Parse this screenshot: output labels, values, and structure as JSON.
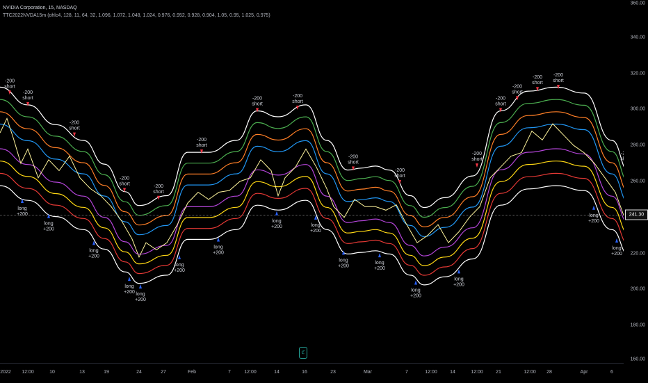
{
  "header": {
    "symbol_line": "NVIDIA Corporation, 15, NASDAQ",
    "indicator_line": "TTC2022NVDA15m (ohlc4, 128, 11, 64, 32, 1.096, 1.072, 1.048, 1.024, 0.976, 0.952, 0.928, 0.904, 1.05, 0.95, 1.025, 0.975)"
  },
  "last_price": "241.30",
  "logo_text": "ℭ",
  "colors": {
    "background": "#000000",
    "band_outer": "#ffffff",
    "band_green": "#4caf50",
    "band_orange": "#ff7f27",
    "band_blue": "#2196f3",
    "band_purple": "#b445d9",
    "band_yellow": "#ffd814",
    "band_red": "#e53935",
    "price_line": "#fff59d",
    "signal_short": "#f23645",
    "signal_long": "#2962ff",
    "axis_text": "#b2b5be"
  },
  "chart_data": {
    "type": "line",
    "title": "NVIDIA Corporation, 15, NASDAQ",
    "xlabel": "",
    "ylabel": "",
    "ylim": [
      160,
      360
    ],
    "y_ticks": [
      "160.00",
      "180.00",
      "200.00",
      "220.00",
      "240.00",
      "260.00",
      "280.00",
      "300.00",
      "320.00",
      "340.00",
      "360.00"
    ],
    "x_ticks": [
      {
        "label": "2022",
        "i": 8
      },
      {
        "label": "12:00",
        "i": 40
      },
      {
        "label": "10",
        "i": 75
      },
      {
        "label": "13",
        "i": 118
      },
      {
        "label": "19",
        "i": 153
      },
      {
        "label": "24",
        "i": 200
      },
      {
        "label": "27",
        "i": 235
      },
      {
        "label": "Feb",
        "i": 276
      },
      {
        "label": "7",
        "i": 330
      },
      {
        "label": "12:00",
        "i": 360
      },
      {
        "label": "14",
        "i": 398
      },
      {
        "label": "16",
        "i": 438
      },
      {
        "label": "23",
        "i": 479
      },
      {
        "label": "Mar",
        "i": 529
      },
      {
        "label": "7",
        "i": 585
      },
      {
        "label": "12:00",
        "i": 620
      },
      {
        "label": "14",
        "i": 651
      },
      {
        "label": "12:00",
        "i": 686
      },
      {
        "label": "21",
        "i": 717
      },
      {
        "label": "12:00",
        "i": 762
      },
      {
        "label": "28",
        "i": 790
      },
      {
        "label": "Apr",
        "i": 840
      },
      {
        "label": "6",
        "i": 880
      }
    ],
    "base_curve": {
      "x": [
        0,
        40,
        80,
        120,
        150,
        180,
        200,
        240,
        270,
        300,
        340,
        370,
        400,
        440,
        470,
        500,
        520,
        540,
        560,
        590,
        610,
        640,
        680,
        720,
        760,
        800,
        840,
        880,
        905
      ],
      "center": [
        285,
        276,
        266,
        258,
        246,
        232,
        225,
        230,
        252,
        252,
        258,
        273,
        270,
        276,
        258,
        243,
        244,
        245,
        243,
        230,
        224,
        229,
        240,
        273,
        283,
        285,
        282,
        258,
        242
      ]
    },
    "bands": [
      {
        "level": 1.096,
        "color": "#ffffff"
      },
      {
        "level": 1.072,
        "color": "#4caf50"
      },
      {
        "level": 1.048,
        "color": "#ff7f27"
      },
      {
        "level": 1.024,
        "color": "#2196f3"
      },
      {
        "level": 0.976,
        "color": "#b445d9"
      },
      {
        "level": 0.952,
        "color": "#ffd814"
      },
      {
        "level": 0.928,
        "color": "#e53935"
      },
      {
        "level": 0.904,
        "color": "#ffffff"
      }
    ],
    "price_series": {
      "x": [
        0,
        10,
        20,
        30,
        40,
        55,
        70,
        85,
        100,
        115,
        130,
        145,
        160,
        175,
        190,
        200,
        210,
        225,
        240,
        255,
        270,
        285,
        300,
        315,
        330,
        345,
        360,
        375,
        390,
        400,
        410,
        425,
        440,
        455,
        470,
        480,
        495,
        510,
        525,
        540,
        555,
        570,
        585,
        600,
        615,
        630,
        645,
        660,
        675,
        690,
        705,
        720,
        735,
        750,
        765,
        780,
        795,
        810,
        825,
        840,
        855,
        870,
        885,
        900,
        905
      ],
      "y": [
        287,
        295,
        283,
        270,
        278,
        262,
        272,
        266,
        274,
        262,
        256,
        252,
        246,
        238,
        228,
        218,
        226,
        222,
        226,
        236,
        248,
        254,
        250,
        254,
        255,
        260,
        262,
        272,
        266,
        252,
        262,
        268,
        278,
        268,
        256,
        246,
        240,
        250,
        246,
        246,
        244,
        247,
        236,
        226,
        230,
        236,
        226,
        232,
        240,
        246,
        262,
        268,
        274,
        276,
        288,
        283,
        292,
        286,
        280,
        276,
        270,
        262,
        254,
        238,
        241
      ]
    },
    "signals": [
      {
        "i": 14,
        "side": "short",
        "text": "-200",
        "sub": "short"
      },
      {
        "i": 32,
        "side": "long",
        "text": "long",
        "sub": "+200"
      },
      {
        "i": 40,
        "side": "short",
        "text": "-200",
        "sub": "short"
      },
      {
        "i": 70,
        "side": "long",
        "text": "long",
        "sub": "+200"
      },
      {
        "i": 107,
        "side": "short",
        "text": "-200",
        "sub": "short"
      },
      {
        "i": 135,
        "side": "long",
        "text": "long",
        "sub": "+200"
      },
      {
        "i": 179,
        "side": "short",
        "text": "-200",
        "sub": "short"
      },
      {
        "i": 186,
        "side": "long",
        "text": "long",
        "sub": "+200"
      },
      {
        "i": 202,
        "side": "long",
        "text": "long",
        "sub": "+200"
      },
      {
        "i": 228,
        "side": "short",
        "text": "-200",
        "sub": "short"
      },
      {
        "i": 258,
        "side": "long",
        "text": "long",
        "sub": "+200"
      },
      {
        "i": 290,
        "side": "short",
        "text": "-200",
        "sub": "short"
      },
      {
        "i": 314,
        "side": "long",
        "text": "long",
        "sub": "+200"
      },
      {
        "i": 370,
        "side": "short",
        "text": "-200",
        "sub": "short"
      },
      {
        "i": 398,
        "side": "long",
        "text": "long",
        "sub": "+200"
      },
      {
        "i": 428,
        "side": "short",
        "text": "-200",
        "sub": "short"
      },
      {
        "i": 454,
        "side": "long",
        "text": "long",
        "sub": "+200"
      },
      {
        "i": 494,
        "side": "long",
        "text": "long",
        "sub": "+200"
      },
      {
        "i": 508,
        "side": "short",
        "text": "-200",
        "sub": "short"
      },
      {
        "i": 546,
        "side": "long",
        "text": "long",
        "sub": "+200"
      },
      {
        "i": 575,
        "side": "short",
        "text": "-200",
        "sub": "short"
      },
      {
        "i": 598,
        "side": "long",
        "text": "long",
        "sub": "+200"
      },
      {
        "i": 660,
        "side": "long",
        "text": "long",
        "sub": "+200"
      },
      {
        "i": 686,
        "side": "short",
        "text": "-200",
        "sub": "short"
      },
      {
        "i": 720,
        "side": "short",
        "text": "-200",
        "sub": "short"
      },
      {
        "i": 744,
        "side": "short",
        "text": "-200",
        "sub": "short"
      },
      {
        "i": 773,
        "side": "short",
        "text": "-200",
        "sub": "short"
      },
      {
        "i": 803,
        "side": "short",
        "text": "-200",
        "sub": "short"
      },
      {
        "i": 854,
        "side": "long",
        "text": "long",
        "sub": "+200"
      },
      {
        "i": 887,
        "side": "long",
        "text": "long",
        "sub": "+200"
      },
      {
        "i": 900,
        "side": "short",
        "text": "-200",
        "sub": "short"
      }
    ]
  }
}
